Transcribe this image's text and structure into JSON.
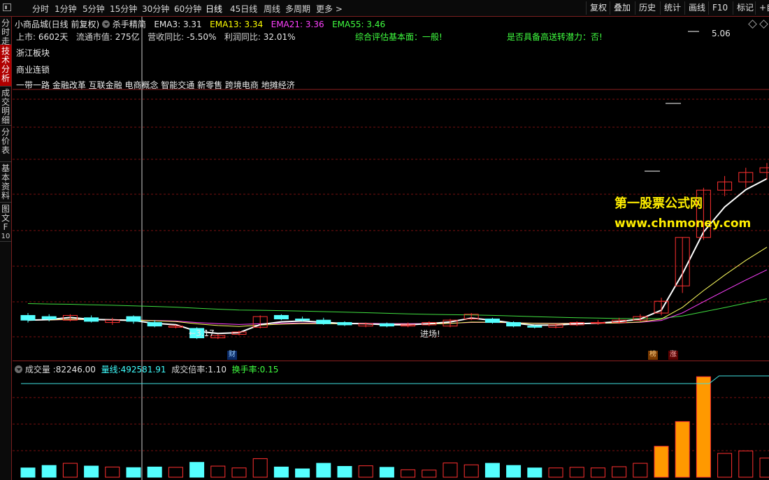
{
  "toolbar": {
    "periods": [
      "分时",
      "1分钟",
      "5分钟",
      "15分钟",
      "30分钟",
      "60分钟",
      "日线",
      "45日线",
      "周线",
      "多周期"
    ],
    "active_period": "日线",
    "more_label": "更多 >",
    "right_buttons": [
      "复权",
      "叠加",
      "历史",
      "统计",
      "画线",
      "F10",
      "标记",
      "+自"
    ]
  },
  "sidebar": {
    "tabs": [
      {
        "label": "分时走势",
        "chars": [
          "分",
          "时",
          "走",
          "势"
        ]
      },
      {
        "label": "技术分析",
        "chars": [
          "技",
          "术",
          "分",
          "析"
        ]
      },
      {
        "label": "成交明细",
        "chars": [
          "成",
          "交",
          "明",
          "细"
        ]
      },
      {
        "label": "分价表",
        "chars": [
          "分",
          "价",
          "表"
        ]
      },
      {
        "label": "基本资料",
        "chars": [
          "基",
          "本",
          "资",
          "料"
        ]
      },
      {
        "label": "图文F10",
        "chars": [
          "图",
          "文",
          "F",
          "10"
        ]
      }
    ]
  },
  "header": {
    "stock_title": "小商品城(日线 前复权)",
    "formula_name": "杀手精简",
    "ema3_label": "EMA3:",
    "ema3_value": "3.31",
    "ema13_label": "EMA13:",
    "ema13_value": "3.34",
    "ema21_label": "EMA21:",
    "ema21_value": "3.36",
    "ema55_label": "EMA55:",
    "ema55_value": "3.46"
  },
  "fundamentals": {
    "listed_label": "上市:",
    "listed_value": "6602天",
    "mcap_label": "流通市值:",
    "mcap_value": "275亿",
    "revenue_label": "营收同比:",
    "revenue_value": "-5.50%",
    "profit_label": "利润同比:",
    "profit_value": "32.01%",
    "rating": "综合评估基本面：一般!",
    "transfer": "是否具备高送转潜力：否!"
  },
  "sectors": [
    "浙江板块",
    "商业连锁",
    "一带一路 金融改革 互联金融 电商概念 智能交通 新零售 跨境电商 地摊经济"
  ],
  "annotations": {
    "high_price": "5.06",
    "low_price": "3.17",
    "entry": "进场!",
    "fin_tag": "财",
    "bang_tag": "榜",
    "zhang_tag": "涨"
  },
  "watermark": {
    "line1": "第一股票公式网",
    "line2": "www.chnmoney.com"
  },
  "volume_header": {
    "vol_label": "成交量 :",
    "vol_value": "82246.00",
    "liang_label": "量线:",
    "liang_value": "492581.91",
    "ratio_label": "成交倍率:",
    "ratio_value": "1.10",
    "turnover_label": "换手率:",
    "turnover_value": "0.15"
  },
  "colors": {
    "up": "#ff3030",
    "down": "#54ffff",
    "ema3": "#ffffff",
    "ema13": "#ffff60",
    "ema21": "#ff40ff",
    "ema55": "#40e040",
    "vol_hot": "#ff9900",
    "grid": "#7a1010"
  },
  "chart_data": {
    "type": "candlestick",
    "price_range": [
      3.0,
      5.2
    ],
    "candles": [
      {
        "o": 3.37,
        "c": 3.33,
        "h": 3.39,
        "l": 3.31,
        "v": 0.3
      },
      {
        "o": 3.36,
        "c": 3.34,
        "h": 3.38,
        "l": 3.32,
        "v": 0.38
      },
      {
        "o": 3.33,
        "c": 3.37,
        "h": 3.38,
        "l": 3.32,
        "v": 0.45
      },
      {
        "o": 3.35,
        "c": 3.32,
        "h": 3.37,
        "l": 3.31,
        "v": 0.36
      },
      {
        "o": 3.31,
        "c": 3.33,
        "h": 3.35,
        "l": 3.29,
        "v": 0.33
      },
      {
        "o": 3.36,
        "c": 3.32,
        "h": 3.37,
        "l": 3.3,
        "v": 0.31
      },
      {
        "o": 3.31,
        "c": 3.28,
        "h": 3.33,
        "l": 3.27,
        "v": 0.33
      },
      {
        "o": 3.27,
        "c": 3.28,
        "h": 3.29,
        "l": 3.26,
        "v": 0.32
      },
      {
        "o": 3.26,
        "c": 3.18,
        "h": 3.27,
        "l": 3.17,
        "v": 0.48
      },
      {
        "o": 3.18,
        "c": 3.2,
        "h": 3.21,
        "l": 3.17,
        "v": 0.36
      },
      {
        "o": 3.21,
        "c": 3.23,
        "h": 3.24,
        "l": 3.2,
        "v": 0.3
      },
      {
        "o": 3.27,
        "c": 3.36,
        "h": 3.37,
        "l": 3.26,
        "v": 0.6
      },
      {
        "o": 3.37,
        "c": 3.34,
        "h": 3.38,
        "l": 3.33,
        "v": 0.33
      },
      {
        "o": 3.34,
        "c": 3.33,
        "h": 3.36,
        "l": 3.32,
        "v": 0.27
      },
      {
        "o": 3.33,
        "c": 3.3,
        "h": 3.35,
        "l": 3.29,
        "v": 0.45
      },
      {
        "o": 3.31,
        "c": 3.29,
        "h": 3.32,
        "l": 3.28,
        "v": 0.35
      },
      {
        "o": 3.28,
        "c": 3.3,
        "h": 3.31,
        "l": 3.27,
        "v": 0.37
      },
      {
        "o": 3.3,
        "c": 3.28,
        "h": 3.31,
        "l": 3.27,
        "v": 0.32
      },
      {
        "o": 3.28,
        "c": 3.29,
        "h": 3.31,
        "l": 3.27,
        "v": 0.24
      },
      {
        "o": 3.29,
        "c": 3.31,
        "h": 3.32,
        "l": 3.28,
        "v": 0.23
      },
      {
        "o": 3.28,
        "c": 3.33,
        "h": 3.34,
        "l": 3.27,
        "v": 0.46
      },
      {
        "o": 3.34,
        "c": 3.38,
        "h": 3.39,
        "l": 3.33,
        "v": 0.4
      },
      {
        "o": 3.34,
        "c": 3.31,
        "h": 3.35,
        "l": 3.3,
        "v": 0.45
      },
      {
        "o": 3.31,
        "c": 3.28,
        "h": 3.32,
        "l": 3.27,
        "v": 0.38
      },
      {
        "o": 3.28,
        "c": 3.27,
        "h": 3.29,
        "l": 3.26,
        "v": 0.3
      },
      {
        "o": 3.27,
        "c": 3.29,
        "h": 3.3,
        "l": 3.26,
        "v": 0.3
      },
      {
        "o": 3.29,
        "c": 3.31,
        "h": 3.32,
        "l": 3.28,
        "v": 0.32
      },
      {
        "o": 3.31,
        "c": 3.31,
        "h": 3.33,
        "l": 3.29,
        "v": 0.3
      },
      {
        "o": 3.31,
        "c": 3.33,
        "h": 3.35,
        "l": 3.3,
        "v": 0.34
      },
      {
        "o": 3.33,
        "c": 3.36,
        "h": 3.38,
        "l": 3.32,
        "v": 0.45
      },
      {
        "o": 3.39,
        "c": 3.49,
        "h": 3.52,
        "l": 3.37,
        "v": 1.0
      },
      {
        "o": 3.62,
        "c": 4.03,
        "h": 4.03,
        "l": 3.56,
        "v": 1.8
      },
      {
        "o": 4.03,
        "c": 4.43,
        "h": 4.45,
        "l": 4.01,
        "v": 3.25
      },
      {
        "o": 4.43,
        "c": 4.5,
        "h": 4.55,
        "l": 4.38,
        "v": 0.77
      },
      {
        "o": 4.5,
        "c": 4.58,
        "h": 4.62,
        "l": 4.45,
        "v": 0.85
      },
      {
        "o": 4.58,
        "c": 4.62,
        "h": 4.66,
        "l": 4.52,
        "v": 0.62
      }
    ]
  }
}
